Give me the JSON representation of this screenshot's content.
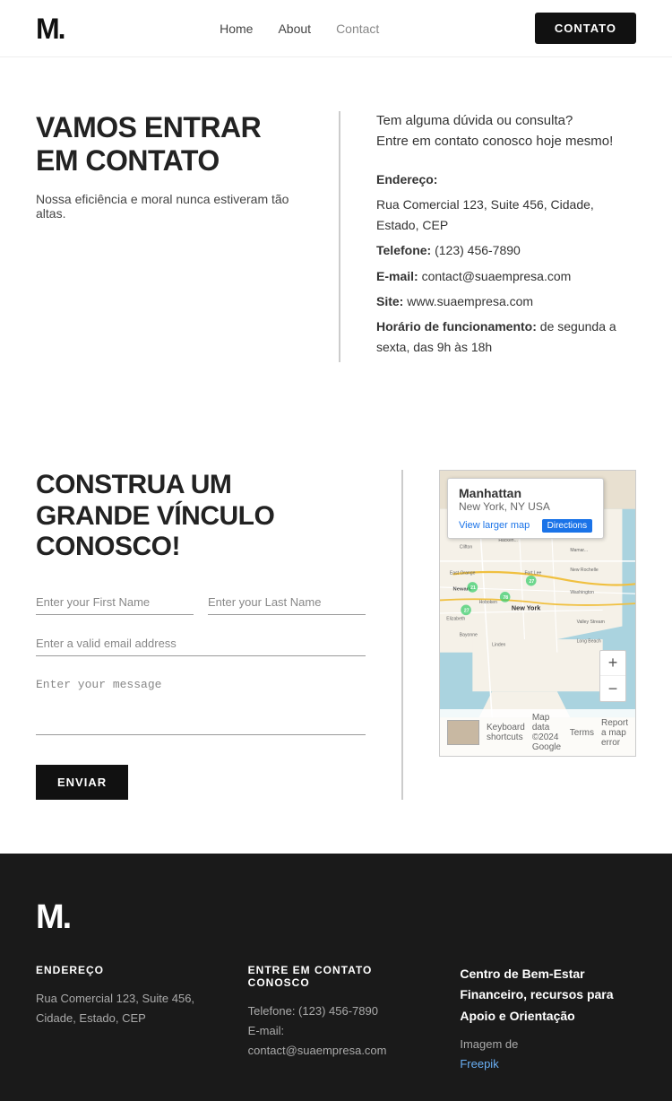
{
  "header": {
    "logo": "M.",
    "nav": {
      "home": "Home",
      "about": "About",
      "contact": "Contact"
    },
    "cta": "CONTATO"
  },
  "section1": {
    "left": {
      "heading": "VAMOS ENTRAR EM CONTATO",
      "subtext": "Nossa eficiência e moral nunca estiveram tão altas."
    },
    "right": {
      "tagline_line1": "Tem alguma dúvida ou consulta?",
      "tagline_line2": "Entre em contato conosco hoje mesmo!",
      "address_label": "Endereço:",
      "address_value": "Rua Comercial 123, Suite 456, Cidade, Estado, CEP",
      "phone_label": "Telefone:",
      "phone_value": "(123) 456-7890",
      "email_label": "E-mail:",
      "email_value": "contact@suaempresa.com",
      "site_label": "Site:",
      "site_value": "www.suaempresa.com",
      "hours_label": "Horário de funcionamento:",
      "hours_value": "de segunda a sexta, das 9h às 18h"
    }
  },
  "section2": {
    "left": {
      "heading_line1": "CONSTRUA UM",
      "heading_line2": "GRANDE VÍNCULO",
      "heading_line3": "CONOSCO!",
      "first_name_placeholder": "Enter your First Name",
      "last_name_placeholder": "Enter your Last Name",
      "email_placeholder": "Enter a valid email address",
      "message_placeholder": "Enter your message",
      "submit_label": "ENVIAR"
    },
    "map": {
      "place_name": "Manhattan",
      "place_sub": "New York, NY USA",
      "directions_label": "Directions",
      "view_larger": "View larger map",
      "keyboard_shortcuts": "Keyboard shortcuts",
      "map_data": "Map data ©2024 Google",
      "terms": "Terms",
      "report": "Report a map error"
    }
  },
  "footer": {
    "logo": "M.",
    "address_heading": "ENDEREÇO",
    "address_value": "Rua Comercial 123, Suite 456, Cidade, Estado, CEP",
    "contact_heading": "ENTRE EM CONTATO CONOSCO",
    "contact_phone": "Telefone: (123) 456-7890",
    "contact_email": "E-mail: contact@suaempresa.com",
    "right_heading": "Centro de Bem-Estar Financeiro, recursos para Apoio e Orientação",
    "image_from": "Imagem de",
    "image_link": "Freepik"
  }
}
